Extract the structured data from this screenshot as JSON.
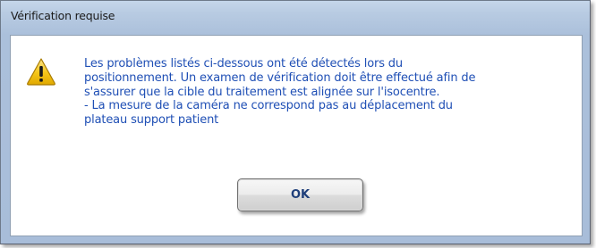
{
  "window": {
    "title": "Vérification requise"
  },
  "dialog": {
    "icon": "warning-icon",
    "message": "Les problèmes listés ci-dessous ont été détectés lors du\npositionnement. Un examen de vérification doit être effectué afin de\ns'assurer que la cible du traitement est alignée sur l'isocentre.\n- La mesure de la caméra ne correspond pas au déplacement du\nplateau support patient",
    "ok_label": "OK"
  },
  "colors": {
    "message_text": "#1f4fb5",
    "frame": "#abc0db",
    "warning_fill": "#f5c518"
  }
}
